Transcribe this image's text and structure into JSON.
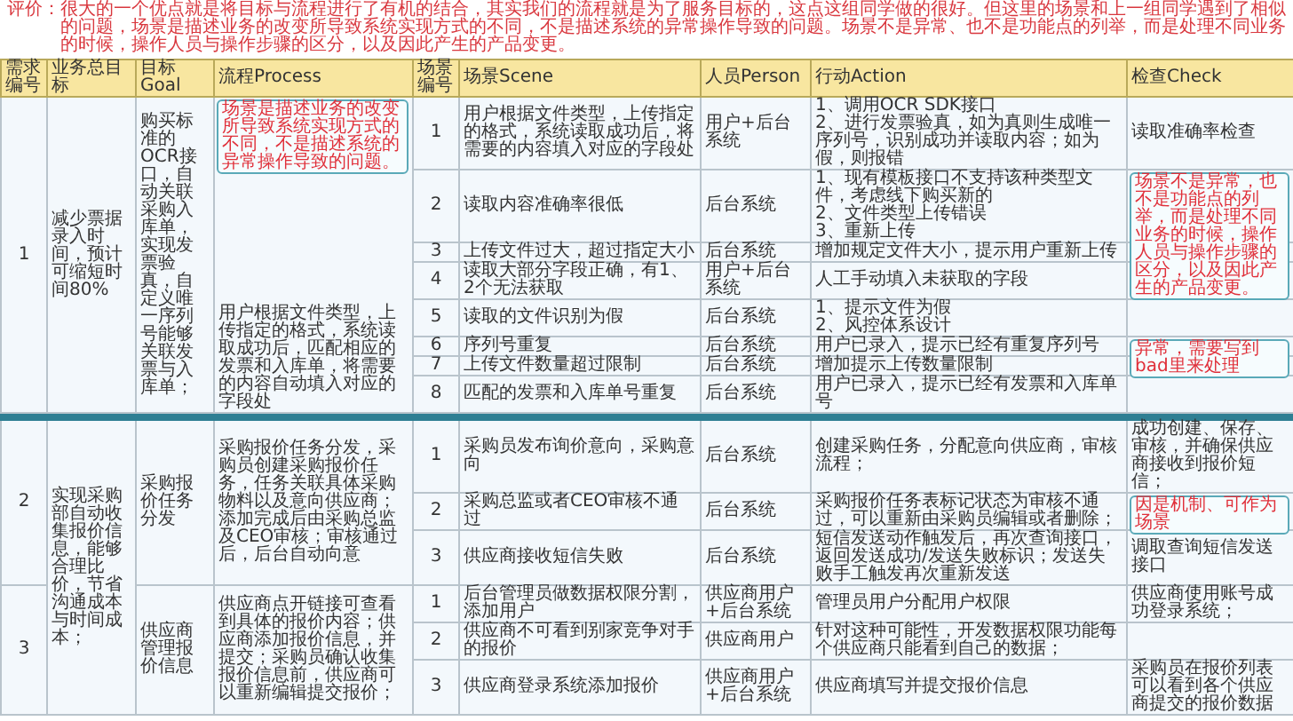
{
  "comment": {
    "title": "评价：",
    "text": "很大的一个优点就是将目标与流程进行了有机的结合，其实我们的流程就是为了服务目标的，这点这组同学做的很好。但这里的场景和上一组同学遇到了相似的问题，场景是描述业务的改变所导致系统实现方式的不同，不是描述系统的异常操作导致的问题。场景不是异常、也不是功能点的列举，而是处理不同业务的时候，操作人员与操作步骤的区分，以及因此产生的产品变更。"
  },
  "table": {
    "columns": [
      "需求编号",
      "业务总目标",
      "目标Goal",
      "流程Process",
      "场景编号",
      "场景Scene",
      "人员Person",
      "行动Action",
      "检查Check"
    ],
    "groups": [
      {
        "id": "1",
        "business_goal": "减少票据录入时间，预计可缩短时间80%",
        "goal": "购买标准的OCR接口，自动关联采购入库单，实现发票验真，自定义唯一序列号能够关联发票与入库单；",
        "process": "用户根据文件类型，上传指定的格式，系统读取成功后，匹配相应的发票和入库单，将需要的内容自动填入对应的字段处",
        "callout": "场景是描述业务的改变所导致系统实现方式的不同，不是描述系统的异常操作导致的问题。",
        "divider_after": true,
        "scenes": [
          {
            "no": "1",
            "scene": "用户根据文件类型，上传指定的格式，系统读取成功后，将需要的内容填入对应的字段处",
            "person": "用户+后台系统",
            "action": [
              "1、调用OCR SDK接口",
              "2、进行发票验真，如为真则生成唯一序列号，识别成功并读取内容；如为假，则报错"
            ],
            "check": "读取准确率检查"
          },
          {
            "no": "2",
            "scene": "读取内容准确率很低",
            "person": "后台系统",
            "action": [
              "1、现有模板接口不支持该种类型文件，考虑线下购买新的",
              "2、文件类型上传错误",
              "3、重新上传"
            ],
            "callout": "场景不是异常，也不是功能点的列举，而是处理不同业务的时候，操作人员与操作步骤的区分，以及因此产生的产品变更。"
          },
          {
            "no": "3",
            "scene": "上传文件过大，超过指定大小",
            "person": "后台系统",
            "action": [
              "增加规定文件大小，提示用户重新上传"
            ]
          },
          {
            "no": "4",
            "scene": "读取大部分字段正确，有1、2个无法获取",
            "person": "用户+后台系统",
            "action": [
              "人工手动填入未获取的字段"
            ]
          },
          {
            "no": "5",
            "scene": "读取的文件识别为假",
            "person": "后台系统",
            "action": [
              "1、提示文件为假",
              "2、风控体系设计"
            ]
          },
          {
            "no": "6",
            "scene": "序列号重复",
            "person": "后台系统",
            "action": [
              "用户已录入，提示已经有重复序列号"
            ],
            "callout": "异常，需要写到bad里来处理"
          },
          {
            "no": "7",
            "scene": "上传文件数量超过限制",
            "person": "后台系统",
            "action": [
              "增加提示上传数量限制"
            ]
          },
          {
            "no": "8",
            "scene": "匹配的发票和入库单号重复",
            "person": "后台系统",
            "action": [
              "用户已录入，提示已经有发票和入库单号"
            ]
          }
        ]
      },
      {
        "id": "2",
        "goal": "采购报价任务分发",
        "process": "采购报价任务分发，采购员创建采购报价任务，任务关联具体采购物料以及意向供应商；添加完成后由采购总监及CEO审核；审核通过后，后台自动向意",
        "divider_after": false,
        "scenes": [
          {
            "no": "1",
            "scene": "采购员发布询价意向，采购意向",
            "person": "后台系统",
            "action": [
              "创建采购任务，分配意向供应商，审核流程；"
            ],
            "check": "成功创建、保存、审核，并确保供应商接收到报价短信；"
          },
          {
            "no": "2",
            "scene": "采购总监或者CEO审核不通过",
            "person": "后台系统",
            "action": [
              "采购报价任务表标记状态为审核不通过，可以重新由采购员编辑或者删除；"
            ],
            "callout": "因是机制、可作为场景"
          },
          {
            "no": "3",
            "scene": "供应商接收短信失败",
            "person": "后台系统",
            "action": [
              "短信发送动作触发后，再次查询接口，返回发送成功/发送失败标识；发送失败手工触发再次重新发送"
            ],
            "check": "调取查询短信发送接口"
          }
        ]
      },
      {
        "id": "3",
        "business_goal": "实现采购部自动收集报价信息，能够合理比价，节省沟通成本与时间成本；",
        "goal": "供应商管理报价信息",
        "process": "供应商点开链接可查看到具体的报价内容；供应商添加报价信息，并提交；采购员确认收集报价信息前，供应商可以重新编辑提交报价；",
        "divider_after": false,
        "scenes": [
          {
            "no": "1",
            "scene": "后台管理员做数据权限分割，添加用户",
            "person": "供应商用户+后台系统",
            "action": [
              "管理员用户分配用户权限"
            ],
            "check": "供应商使用账号成功登录系统；"
          },
          {
            "no": "2",
            "scene": "供应商不可看到别家竞争对手的报价",
            "person": "供应商用户",
            "action": [
              "针对这种可能性，开发数据权限功能每个供应商只能看到自己的数据；"
            ]
          },
          {
            "no": "3",
            "scene": "供应商登录系统添加报价",
            "person": "供应商用户+后台系统",
            "action": [
              "供应商填写并提交报价信息"
            ],
            "check": "采购员在报价列表可以看到各个供应商提交的报价数据"
          }
        ]
      }
    ]
  }
}
